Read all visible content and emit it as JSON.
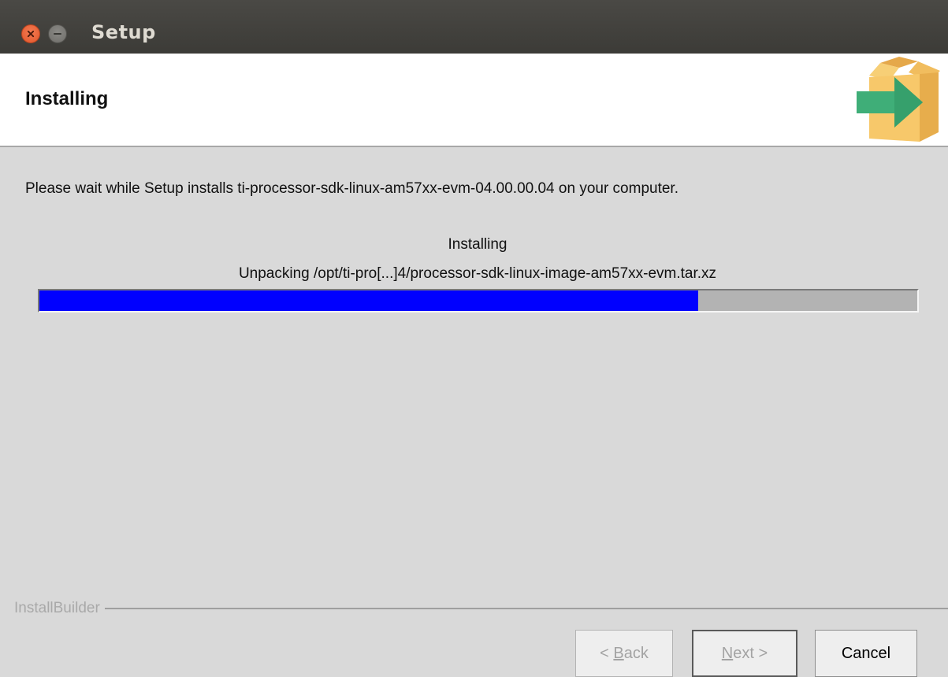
{
  "window": {
    "title": "Setup"
  },
  "header": {
    "title": "Installing",
    "logo_icon": "package-arrow-icon"
  },
  "body": {
    "description": "Please wait while Setup installs ti-processor-sdk-linux-am57xx-evm-04.00.00.04 on your computer.",
    "status_title": "Installing",
    "status_detail": "Unpacking /opt/ti-pro[...]4/processor-sdk-linux-image-am57xx-evm.tar.xz",
    "progress_fraction": 0.75,
    "progress_color": "#0000ff"
  },
  "footer": {
    "brand": "InstallBuilder",
    "back": {
      "prefix": "< ",
      "mnemonic": "B",
      "rest": "ack"
    },
    "next": {
      "mnemonic": "N",
      "rest": "ext",
      "suffix": " >"
    },
    "cancel_label": "Cancel"
  }
}
